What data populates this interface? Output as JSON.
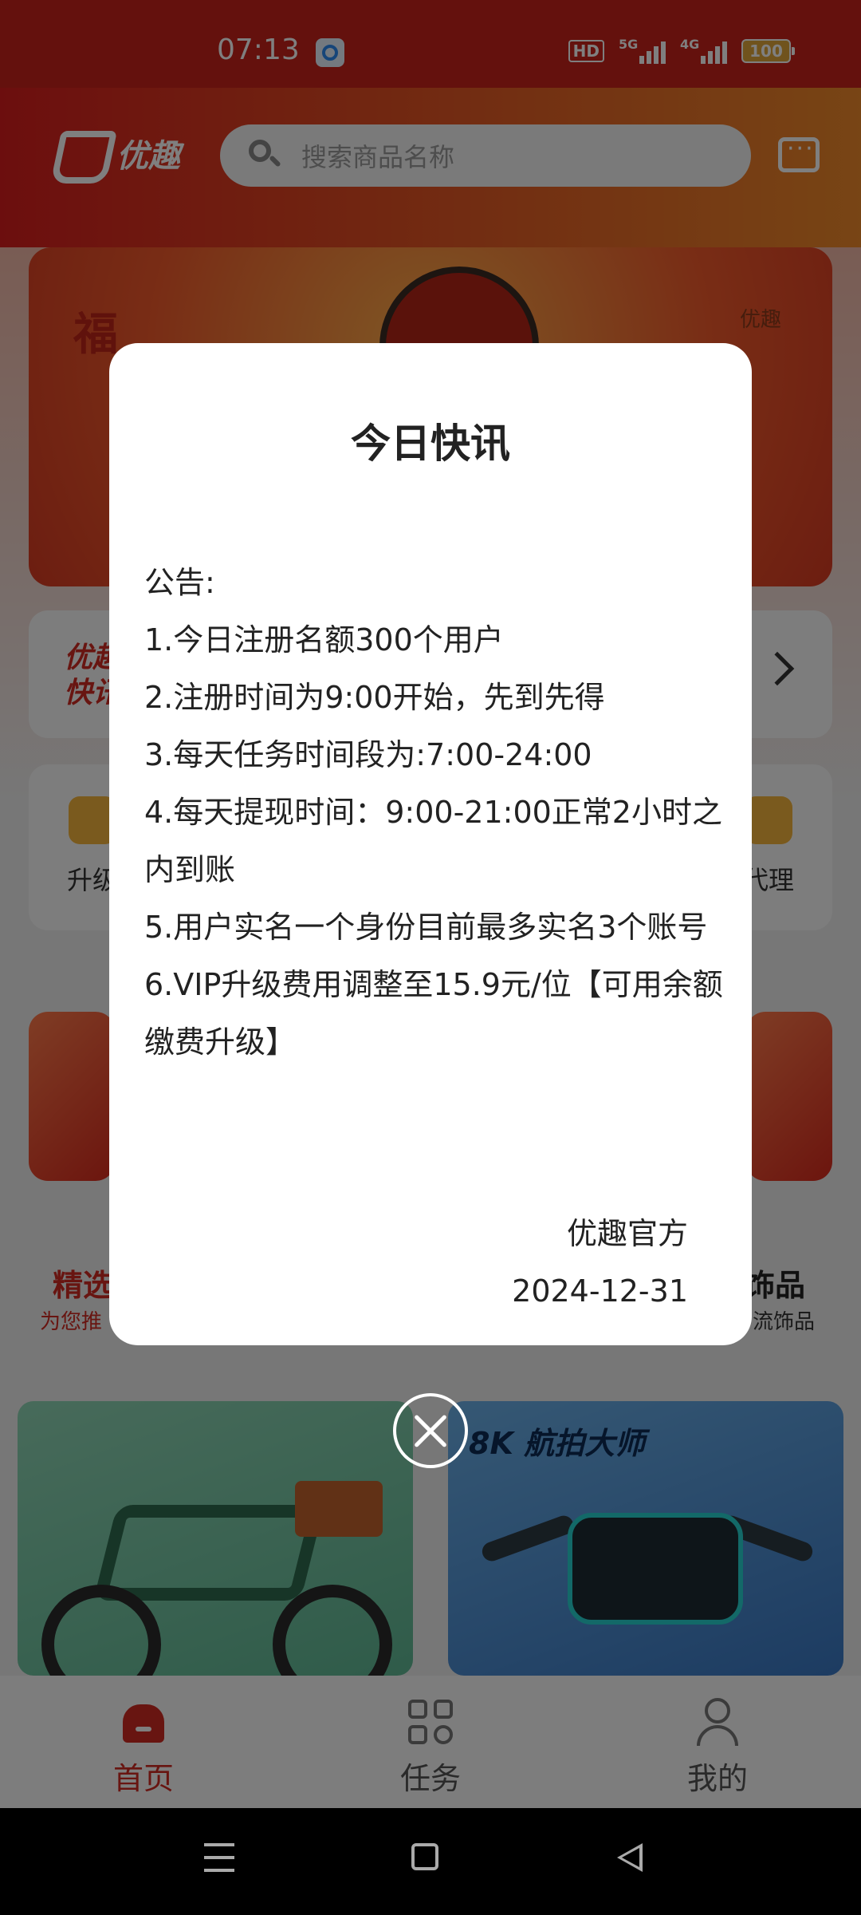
{
  "status_bar": {
    "time": "07:13",
    "hd_label": "HD",
    "network_1": "5G",
    "network_2": "4G",
    "battery": "100"
  },
  "header": {
    "logo_text": "优趣",
    "search_placeholder": "搜索商品名称"
  },
  "banner": {
    "fu_text": "福",
    "brand_tag": "优趣"
  },
  "news_bar": {
    "label": "优趣快讯"
  },
  "func_grid": {
    "left_label": "升级",
    "right_label": "代理"
  },
  "sections": {
    "left_title": "精选",
    "left_sub": "为您推",
    "right_title": "饰品",
    "right_sub": "流饰品"
  },
  "products": {
    "drone_title": "8K 航拍大师"
  },
  "modal": {
    "title": "今日快讯",
    "lines": [
      "公告:",
      "1.今日注册名额300个用户",
      "2.注册时间为9:00开始，先到先得",
      "3.每天任务时间段为:7:00-24:00",
      "4.每天提现时间：9:00-21:00正常2小时之内到账",
      "5.用户实名一个身份目前最多实名3个账号",
      "6.VIP升级费用调整至15.9元/位【可用余额缴费升级】"
    ],
    "signature": "优趣官方",
    "date": "2024-12-31"
  },
  "bottom_nav": {
    "items": [
      {
        "label": "首页",
        "icon": "home-icon",
        "active": true
      },
      {
        "label": "任务",
        "icon": "grid-icon",
        "active": false
      },
      {
        "label": "我的",
        "icon": "user-icon",
        "active": false
      }
    ]
  },
  "colors": {
    "brand_red": "#d12b22",
    "header_orange": "#f08a2a"
  }
}
